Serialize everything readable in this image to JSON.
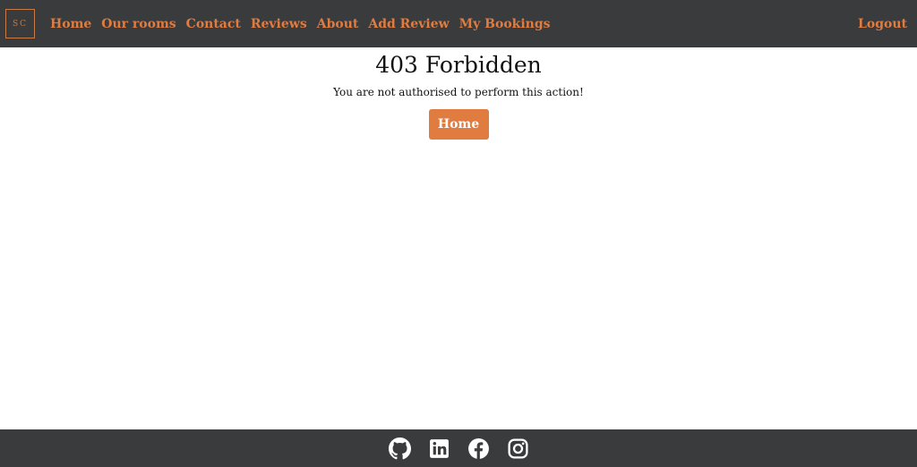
{
  "navbar": {
    "logo_text": "SC",
    "links": [
      "Home",
      "Our rooms",
      "Contact",
      "Reviews",
      "About",
      "Add Review",
      "My Bookings"
    ],
    "logout_label": "Logout"
  },
  "main": {
    "title": "403 Forbidden",
    "message": "You are not authorised to perform this action!",
    "home_button_label": "Home"
  },
  "footer": {
    "social_icons": [
      "github-icon",
      "linkedin-icon",
      "facebook-icon",
      "instagram-icon"
    ]
  },
  "colors": {
    "navbar_background": "#3a3b3d",
    "accent": "#e07c40",
    "page_background": "#ffffff"
  }
}
